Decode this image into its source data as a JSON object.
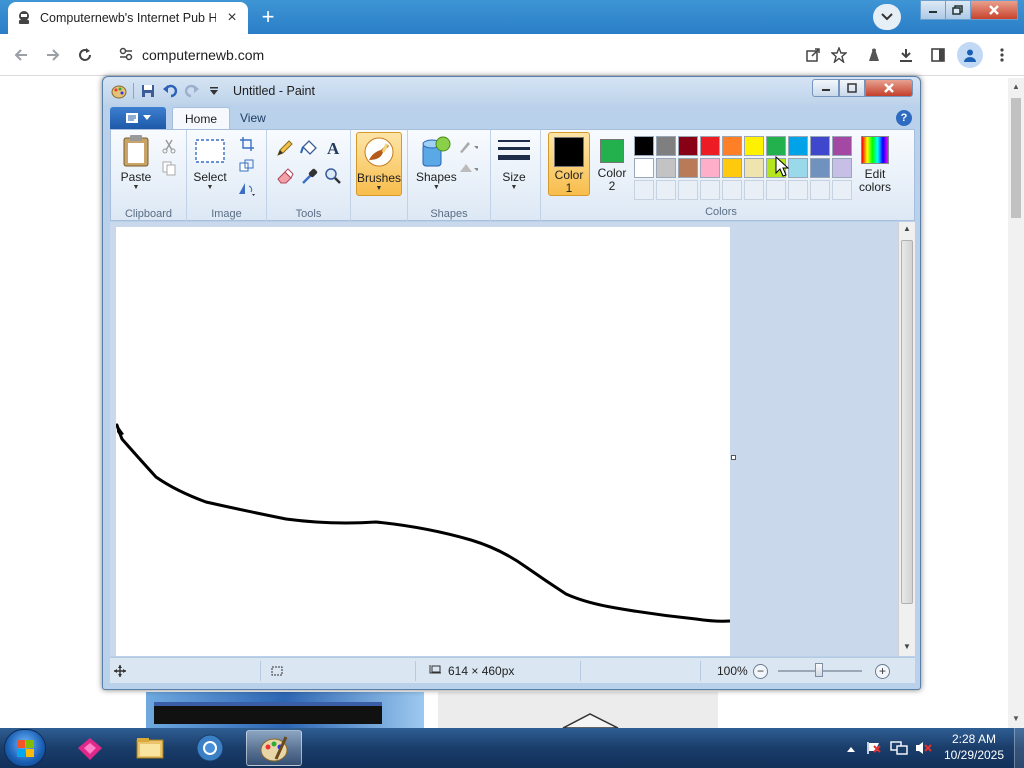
{
  "browser": {
    "tab_title": "Computernewb's Internet Pub H",
    "url": "computernewb.com",
    "new_tab_symbol": "+"
  },
  "paint": {
    "window_title": "Untitled - Paint",
    "tabs": [
      "Home",
      "View"
    ],
    "ribbon": {
      "clipboard": {
        "paste": "Paste",
        "group": "Clipboard"
      },
      "image": {
        "select": "Select",
        "group": "Image"
      },
      "tools": {
        "group": "Tools"
      },
      "brushes": "Brushes",
      "shapes": {
        "label": "Shapes",
        "group": "Shapes"
      },
      "size": "Size",
      "color1": {
        "line1": "Color",
        "line2": "1",
        "value": "#000000"
      },
      "color2": {
        "line1": "Color",
        "line2": "2",
        "value": "#22b14c"
      },
      "edit_colors": {
        "line1": "Edit",
        "line2": "colors"
      },
      "colors_group": "Colors",
      "palette_row1": [
        "#000000",
        "#7f7f7f",
        "#880015",
        "#ed1c24",
        "#ff7f27",
        "#fff200",
        "#22b14c",
        "#00a2e8",
        "#3f48cc",
        "#a349a4"
      ],
      "palette_row2": [
        "#ffffff",
        "#c3c3c3",
        "#b97a57",
        "#ffaec9",
        "#ffc90e",
        "#efe4b0",
        "#b5e61d",
        "#99d9ea",
        "#7092be",
        "#c8bfe7"
      ]
    },
    "status": {
      "canvas_size": "614 × 460px",
      "zoom": "100%"
    }
  },
  "taskbar": {
    "time": "2:28 AM",
    "date": "10/29/2025"
  }
}
